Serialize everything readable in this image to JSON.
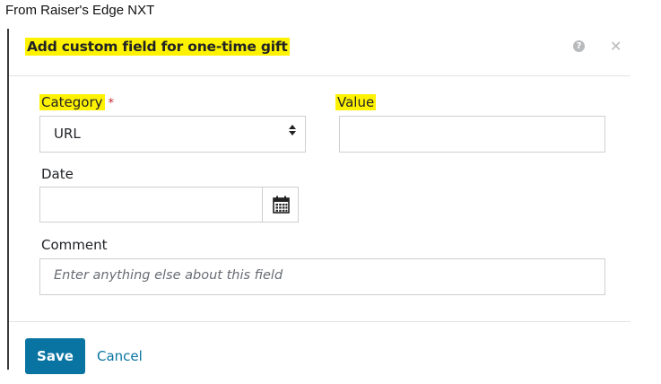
{
  "caption": "From Raiser's Edge NXT",
  "dialog": {
    "title": "Add custom field for one-time gift",
    "help_icon": "question-circle-icon",
    "close_icon": "close-icon",
    "help_glyph": "?",
    "close_glyph": "✕"
  },
  "form": {
    "category_label": "Category",
    "required_marker": "*",
    "category_value": "URL",
    "value_label": "Value",
    "value_value": "",
    "date_label": "Date",
    "date_value": "",
    "calendar_icon": "calendar-icon",
    "comment_label": "Comment",
    "comment_placeholder": "Enter anything else about this field"
  },
  "footer": {
    "save_label": "Save",
    "cancel_label": "Cancel"
  },
  "colors": {
    "highlight": "#fff200",
    "primary": "#0974a1",
    "required": "#c5252c"
  }
}
